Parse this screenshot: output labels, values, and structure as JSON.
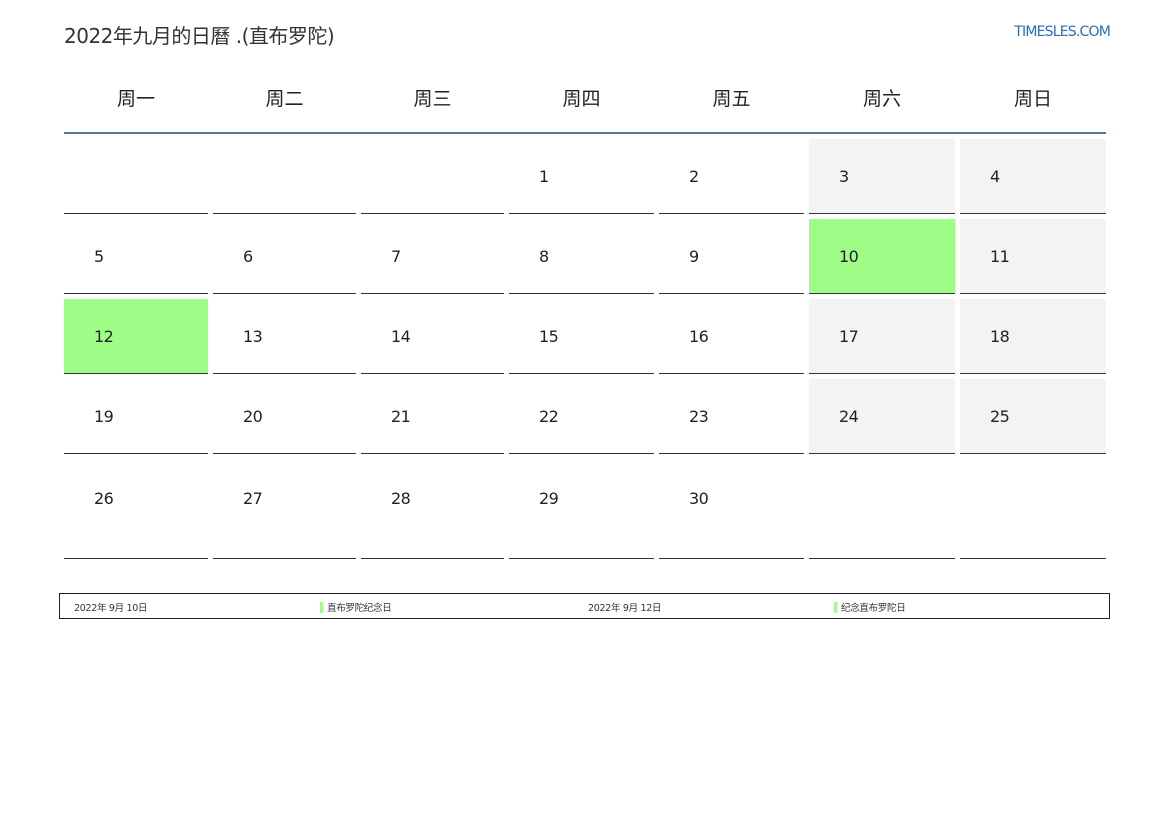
{
  "header": {
    "title": "2022年九月的日曆 .(直布罗陀)",
    "site": "TIMESLES.COM"
  },
  "weekdays": [
    "周一",
    "周二",
    "周三",
    "周四",
    "周五",
    "周六",
    "周日"
  ],
  "weeks": [
    [
      "",
      "",
      "",
      "1",
      "2",
      "3",
      "4"
    ],
    [
      "5",
      "6",
      "7",
      "8",
      "9",
      "10",
      "11"
    ],
    [
      "12",
      "13",
      "14",
      "15",
      "16",
      "17",
      "18"
    ],
    [
      "19",
      "20",
      "21",
      "22",
      "23",
      "24",
      "25"
    ],
    [
      "26",
      "27",
      "28",
      "29",
      "30",
      "",
      ""
    ]
  ],
  "highlighted_days": [
    "10",
    "12"
  ],
  "colors": {
    "holiday": "#9efc87",
    "weekend": "#f3f3f3",
    "header_rule": "#5b7593",
    "link": "#2a6db5"
  },
  "legend": [
    {
      "date": "2022年 9月 10日",
      "name": "直布罗陀纪念日"
    },
    {
      "date": "2022年 9月 12日",
      "name": "纪念直布罗陀日"
    }
  ]
}
